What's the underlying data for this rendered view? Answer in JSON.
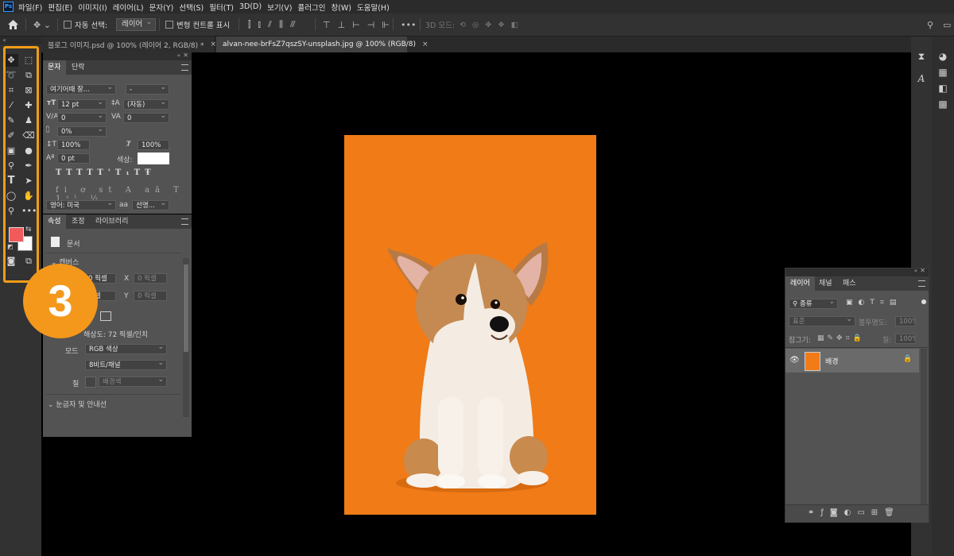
{
  "menu": {
    "items": [
      "파일(F)",
      "편집(E)",
      "이미지(I)",
      "레이어(L)",
      "문자(Y)",
      "선택(S)",
      "필터(T)",
      "3D(D)",
      "보기(V)",
      "플러그인",
      "창(W)",
      "도움말(H)"
    ]
  },
  "options_bar": {
    "auto_select_label": "자동 선택:",
    "auto_select_value": "레이어",
    "transform_controls_label": "변형 컨트롤 표시",
    "mode_3d_label": "3D 모드:"
  },
  "tabs": [
    {
      "label": "블로그 이미지.psd @ 100% (레이어 2, RGB/8) *",
      "close": "×",
      "active": false
    },
    {
      "label": "alvan-nee-brFsZ7qszSY-unsplash.jpg @ 100% (RGB/8)",
      "close": "×",
      "active": true
    }
  ],
  "toolbar": {
    "collapse": "«",
    "step_badge": "3"
  },
  "character_panel": {
    "tab_character": "문자",
    "tab_paragraph": "단락",
    "font_family": "여기어때 잘...",
    "font_style": "-",
    "font_size": "12 pt",
    "leading": "(자동)",
    "kerning": "0",
    "tracking": "0",
    "scale_pct": "0%",
    "vertical_scale": "100%",
    "horizontal_scale": "100%",
    "baseline_shift": "0 pt",
    "color_label": "색상:",
    "language": "영어: 미국",
    "antialias": "선명...",
    "aa_label": "aa"
  },
  "properties_panel": {
    "tab_properties": "속성",
    "tab_adjustments": "조정",
    "tab_libraries": "라이브러리",
    "doc_label": "문서",
    "canvas_section": "캔버스",
    "width_unit": "0 픽셀",
    "x_label": "X",
    "x_value": "0 픽셀",
    "height_unit": "픽셀",
    "y_label": "Y",
    "y_value": "0 픽셀",
    "resolution": "해상도: 72 픽셀/인치",
    "mode_label": "모드",
    "mode_value": "RGB 색상",
    "bits_value": "8비트/채널",
    "fill_label": "칠",
    "fill_value": "배경색",
    "rulers_section": "눈금자 및 안내선"
  },
  "layers_panel": {
    "tab_layers": "레이어",
    "tab_channels": "채널",
    "tab_paths": "패스",
    "filter_kind": "종류",
    "blend_mode": "표준",
    "opacity_label": "불투명도:",
    "opacity_value": "100%",
    "lock_label": "잠그기:",
    "fill_label": "칠:",
    "fill_value": "100%",
    "layer_name": "배경"
  },
  "colors": {
    "foreground": "#f25b5b",
    "background": "#ffffff",
    "photo_bg": "#f07b17",
    "highlight": "#f39c17"
  }
}
